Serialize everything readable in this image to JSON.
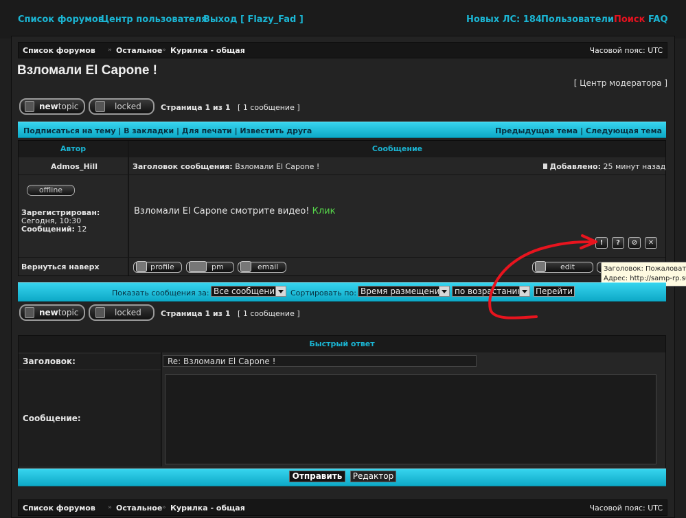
{
  "topnav": {
    "forums": "Список форумов",
    "ucp": "Центр пользователя",
    "logout": "Выход [ Flazy_Fad ]",
    "new_pm": "Новых ЛС: 184",
    "members": "Пользователи",
    "search": "Поиск",
    "faq": "FAQ"
  },
  "breadcrumb": {
    "items": [
      "Список форумов",
      "Остальное",
      "Курилка - общая"
    ],
    "separator": "»",
    "timezone": "Часовой пояс: UTC"
  },
  "topic": {
    "title": "Взломали El Capone !",
    "moderator_link": "[ Центр модератора ]"
  },
  "buttons": {
    "newtopic_a": "new",
    "newtopic_b": "topic",
    "locked": "locked",
    "profile": "profile",
    "pm": "pm",
    "email": "email",
    "edit": "edit"
  },
  "pagination": {
    "text_bold": "Страница 1 из 1",
    "count": "[ 1 сообщение ]"
  },
  "topic_bar": {
    "left": "Подписаться на тему | В закладки | Для печати | Известить друга",
    "right": "Предыдущая тема | Следующая тема"
  },
  "post_table": {
    "col_author": "Автор",
    "col_message": "Сообщение",
    "author": "Admos_Hill",
    "subject_label": "Заголовок сообщения:",
    "subject": "Взломали El Capone !",
    "posted_label": "Добавлено:",
    "posted": "25 минут назад",
    "status": "offline",
    "registered_label": "Зарегистрирован:",
    "registered": "Сегодня, 10:30",
    "posts_label": "Сообщений:",
    "posts": "12",
    "body": "Взломали El Capone смотрите видео!",
    "body_link": "Клик",
    "back_to_top": "Вернуться наверх",
    "icons": [
      "!",
      "?",
      "⊘",
      "✕"
    ]
  },
  "tooltip": {
    "line1": "Заголовок: Пожаловаться",
    "line2": "Адрес: http://samp-rp.su"
  },
  "filter_bar": {
    "show_label": "Показать сообщения за:",
    "show_value": "Все сообщения",
    "sort_label": "Сортировать по:",
    "sort_value": "Время размещения",
    "order_value": "по возрастанию",
    "go": "Перейти"
  },
  "quick_reply": {
    "title": "Быстрый ответ",
    "subject_label": "Заголовок:",
    "subject_value": "Re: Взломали El Capone !",
    "message_label": "Сообщение:",
    "submit": "Отправить",
    "editor": "Редактор"
  },
  "colors": {
    "accent": "#1bb5d3",
    "search_red": "#e5121f",
    "bar_cyan": "#1ec3df",
    "link_green": "#56d64a",
    "annotation_red": "#e8141e"
  }
}
